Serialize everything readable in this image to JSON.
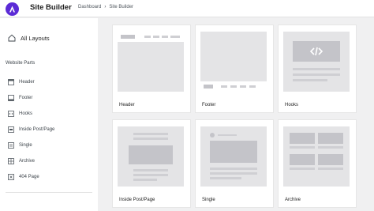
{
  "app": {
    "title": "Site Builder"
  },
  "breadcrumb": {
    "home": "Dashboard",
    "separator": "›",
    "current": "Site Builder"
  },
  "sidebar": {
    "all_layouts": "All Layouts",
    "section_heading": "Website Parts",
    "items": [
      {
        "label": "Header",
        "icon": "header-layout-icon"
      },
      {
        "label": "Footer",
        "icon": "footer-layout-icon"
      },
      {
        "label": "Hooks",
        "icon": "hooks-icon"
      },
      {
        "label": "Inside Post/Page",
        "icon": "inside-post-icon"
      },
      {
        "label": "Single",
        "icon": "single-icon"
      },
      {
        "label": "Archive",
        "icon": "archive-icon"
      },
      {
        "label": "404 Page",
        "icon": "404-page-icon"
      }
    ]
  },
  "cards": [
    {
      "label": "Header"
    },
    {
      "label": "Footer"
    },
    {
      "label": "Hooks"
    },
    {
      "label": "Inside Post/Page"
    },
    {
      "label": "Single"
    },
    {
      "label": "Archive"
    }
  ],
  "colors": {
    "brand": "#5b2bd6",
    "background": "#f0f0f1",
    "thumb": "#e4e4e6"
  }
}
